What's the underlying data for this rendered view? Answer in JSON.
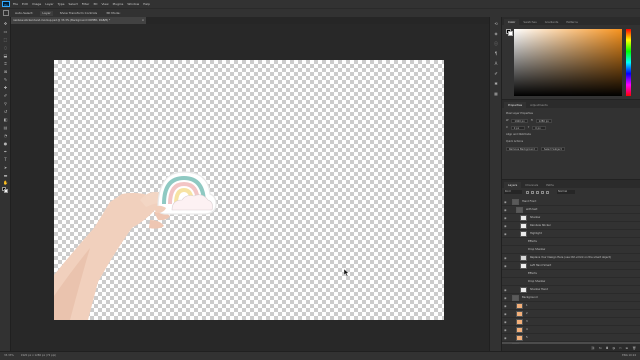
{
  "menu": [
    "File",
    "Edit",
    "Image",
    "Layer",
    "Type",
    "Select",
    "Filter",
    "3D",
    "View",
    "Plugins",
    "Window",
    "Help"
  ],
  "app_logo": "Ps",
  "options": {
    "auto_select": "Auto-Select:",
    "target": "Layer",
    "transform": "Show Transform Controls",
    "mode": "3D Mode:"
  },
  "document": {
    "tab_title": "rainbow-sticker-hand-mockup.psd @ 33.3% (Background COPIED, RGB/8) *",
    "close": "×"
  },
  "panels": {
    "color_tabs": [
      "Color",
      "Swatches",
      "Gradients",
      "Patterns"
    ],
    "props_tabs": [
      "Properties",
      "Adjustments"
    ],
    "layers_tabs": [
      "Layers",
      "Channels",
      "Paths"
    ]
  },
  "properties": {
    "heading": "Pixel Layer Properties",
    "w_label": "W",
    "w_value": "1920 px",
    "h_label": "H",
    "h_value": "1280 px",
    "x_label": "X",
    "x_value": "0 px",
    "y_label": "Y",
    "y_value": "0 px",
    "align_label": "Align and Distribute",
    "quick_label": "Quick Actions",
    "remove_bg": "Remove Background",
    "select_subject": "Select Subject"
  },
  "layers": {
    "filter_kind": "Kind",
    "blend_mode": "Normal",
    "opacity": "Opacity: 100%",
    "fill": "Fill: 100%",
    "items": [
      {
        "name": "Hand Front",
        "indent": 0,
        "type": "group"
      },
      {
        "name": "with text",
        "indent": 1,
        "type": "group"
      },
      {
        "name": "Shadow",
        "indent": 2,
        "type": "layer"
      },
      {
        "name": "Rainbow Sticker",
        "indent": 2,
        "type": "layer"
      },
      {
        "name": "Highlight",
        "indent": 2,
        "type": "layer"
      },
      {
        "name": "Effects",
        "indent": 3,
        "type": "fx"
      },
      {
        "name": "Drop Shadow",
        "indent": 3,
        "type": "fx"
      },
      {
        "name": "Replace Your Design Here (use Ctrl+Click on the smart object)",
        "indent": 2,
        "type": "smart"
      },
      {
        "name": "Left Hand Smart",
        "indent": 2,
        "type": "layer"
      },
      {
        "name": "Effects",
        "indent": 3,
        "type": "fx"
      },
      {
        "name": "Drop Shadow",
        "indent": 3,
        "type": "fx"
      },
      {
        "name": "Shadow Hand",
        "indent": 2,
        "type": "layer"
      },
      {
        "name": "Background",
        "indent": 0,
        "type": "group"
      },
      {
        "name": "1",
        "indent": 1,
        "type": "color"
      },
      {
        "name": "2",
        "indent": 1,
        "type": "color"
      },
      {
        "name": "3",
        "indent": 1,
        "type": "color"
      },
      {
        "name": "4",
        "indent": 1,
        "type": "color"
      },
      {
        "name": "5",
        "indent": 1,
        "type": "color"
      },
      {
        "name": "Background COPIED COLOR - double click",
        "indent": 0,
        "type": "bg"
      }
    ]
  },
  "status": {
    "zoom": "33.33%",
    "doc_size": "1920 px x 1280 px (72 ppi)",
    "tray": "ENG  10:24"
  },
  "colors": {
    "accent": "#31a8ff",
    "picker_hue": "#f7931e",
    "selected_layer": "#4c4c4c"
  }
}
